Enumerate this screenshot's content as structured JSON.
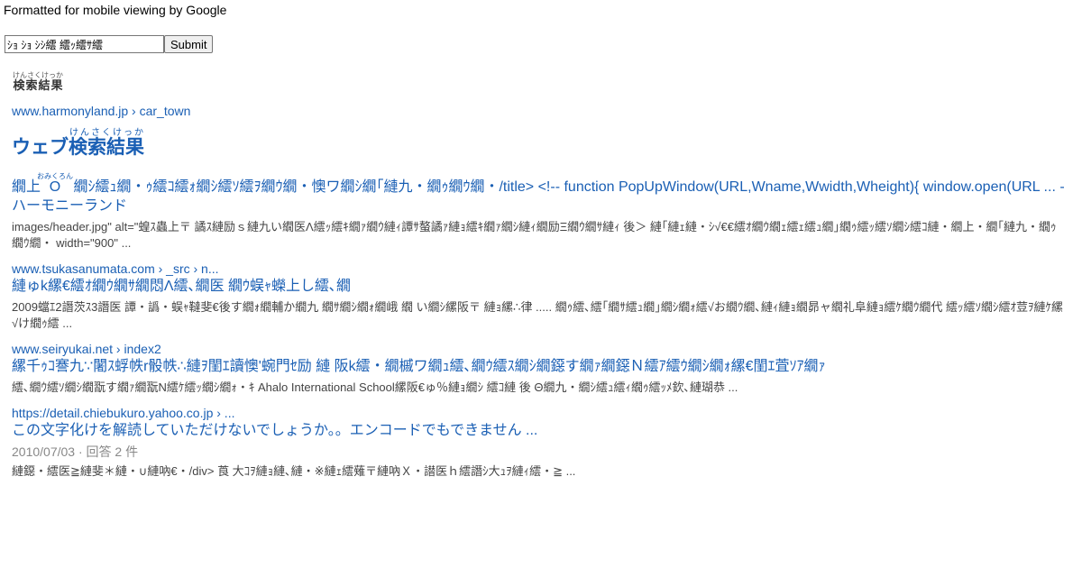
{
  "topbar": {
    "text": "Formatted for mobile viewing by Google"
  },
  "search": {
    "value": "ｼｮ ｼｮ ｼｼ繧 繧ｯ繧ｻ繧",
    "submit_label": "Submit"
  },
  "heading_small": {
    "ruby": "けんさくけっか",
    "text": "検索結果"
  },
  "first_url": "www.harmonyland.jp › car_town",
  "web_heading": {
    "prefix": "ウェブ",
    "ruby": "けんさくけっか",
    "text": "検索結果"
  },
  "results": [
    {
      "title_a": "繝上",
      "title_a_ruby": "おみくろん",
      "title_b": "Ο",
      "title_c": " 繝ｼ繧ｭ繝・ｩ繧ｺ繧ｫ繝ｼ繧ｿ繧ｦ繝ｳ繝・懊ワ繝ｼ繝｢縺九・繝ｩ繝ｳ繝・/title> <!-- function PopUpWindow(URL,Wname,Wwidth,Wheight){ window.open(URL ... - ハーモニーランド",
      "snippet": "images/header.jpg\" alt=\"蝗ｽ蟲上〒 譎ｽ縺励ｓ縺九い繝医Λ繧ｯ繧ｷ繝ｧ繝ｳ縺ｨ譚ｻ螯譎ｧ縺ｮ繧ｷ繝ｧ繝ｼ縺ｨ繝励Ξ繝ｳ繝ｻ縺ｨ 後＞ 縺｢縺ｪ縺・ｼ√€€繧ｵ繝ｳ繝ｪ繧ｪ繧ｭ繝｣繝ｩ繧ｯ繧ｿ繝ｼ繧ｺ縺・繝上・繝｢縺九・繝ｩ繝ｳ繝・ width=\"900\" ..."
    },
    {
      "url": "www.tsukasanumata.com › _src › n...",
      "title": "縺ゅk縲€繧ｵ繝ｳ繝ｻ繝悶Λ繧､繝医 繝ｳ蜈ｬ蠑上し繧､繝",
      "snippet": "2009蟷ｴ2譖茨ｽ3譖医 譚・譌・蜈ｬ韃斐€後す繝ｫ繝輔か繝九 繝ｻ繝ｼ繝ｫ繝峨 繝 い繝ｼ縲阪〒 縺ｮ縲∴律 ..... 繝ｩ繧､繧｢繝ｻ繧ｭ繝｣繝ｼ繝ｫ繧√お繝ｳ繝､縺ｨ縺ｮ繝昴ャ繝礼阜縺ｮ繧ｹ繝ｳ繝代 繧ｯ繧ｿ繝ｼ繧ｵ荳ｦ縺ｹ縲√け繝ｩ繧 ..."
    },
    {
      "url": "www.seiryukai.net › index2",
      "title": "縲千ｩｺ謇九∵闍ｽ蜉帙r骰帙∴縺ｦ閨ｴ讀懊'蜿門ｾ励 縺 阪k繧・繝槭ワ繝ｭ繧､繝ｳ繧ｽ繝ｼ繝鐚す繝ｧ繝鐚Ｎ繧ｱ繧ｳ繝ｼ繝ｫ縲€閨ｴ萓ｿｱ繝ｧ",
      "snippet": "繧､繝ｳ繧ｿ繝ｼ繝翫す繝ｧ繝翫Ν繧ｹ繧ｯ繝ｼ繝ｫ・ｷ Ahalo International School縲阪€ゅ％縺ｮ繝ｼ 繧ｺ縺 後 Θ繝九・繝ｼ繧ｭ繧ｨ繝ｩ繧ｯﾒ欽､縺瑚恭 ..."
    },
    {
      "url": "https://detail.chiebukuro.yahoo.co.jp › ...",
      "title": "この文字化けを解読していただけないでしょうか。。エンコードでもできません ...",
      "meta": "2010/07/03 · 回答 2 件",
      "snippet": "縺鐚・繧医≧縺斐＊縺・∪縺吶€・/div> 莨 大ｺｦ縺ｮ縺､縺・※縺ｪ繧薙〒縺吶Ｘ・譛医ｈ繧譖ｼ大ｭｦ縺ｨ繧・≧ ..."
    }
  ]
}
